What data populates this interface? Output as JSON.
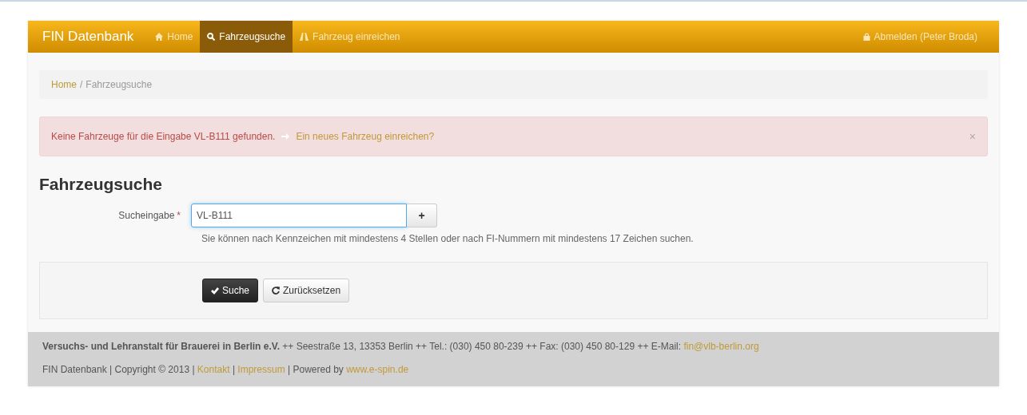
{
  "navbar": {
    "brand": "FIN Datenbank",
    "items": [
      {
        "label": "Home",
        "selected": false
      },
      {
        "label": "Fahrzeugsuche",
        "selected": true
      },
      {
        "label": "Fahrzeug einreichen",
        "selected": false
      }
    ],
    "logout": "Abmelden (Peter Broda)"
  },
  "breadcrumb": [
    {
      "label": "Home",
      "kind": "link"
    },
    {
      "label": "/",
      "kind": "separator"
    },
    {
      "label": "Fahrzeugsuche",
      "kind": "current"
    }
  ],
  "alert": {
    "message": "Keine Fahrzeuge für die Eingabe VL-B111 gefunden.",
    "link": "Ein neues Fahrzeug einreichen?",
    "close": "×"
  },
  "heading": "Fahrzeugsuche",
  "field": {
    "label": "Sucheingabe",
    "required": true,
    "required_mark": "*",
    "value": "VL-B111",
    "addon": "+",
    "help": "Sie können nach Kennzeichen mit mindestens 4 Stellen oder nach FI-Nummern mit mindestens 17 Zeichen suchen."
  },
  "buttons": [
    {
      "label": "Suche",
      "kind": "primary"
    },
    {
      "label": "Zurücksetzen",
      "kind": "reset"
    }
  ],
  "footer": [
    [
      {
        "kind": "text",
        "text": "**Versuchs- und Lehranstalt für Brauerei in Berlin e.V.** ++ Seestraße 13, 13353 Berlin ++ Tel.: (030) 450 80-239 ++ Fax: (030) 450 80-129 ++ E-Mail: "
      },
      {
        "kind": "link",
        "text": "fin@vlb-berlin.org"
      }
    ],
    [
      {
        "kind": "text",
        "text": "FIN Datenbank | Copyright © 2013 | "
      },
      {
        "kind": "link",
        "text": "Kontakt"
      },
      {
        "kind": "text",
        "text": " | "
      },
      {
        "kind": "link",
        "text": "Impressum"
      },
      {
        "kind": "text",
        "text": " | Powered by "
      },
      {
        "kind": "link",
        "text": "www.e-spin.de"
      }
    ]
  ]
}
